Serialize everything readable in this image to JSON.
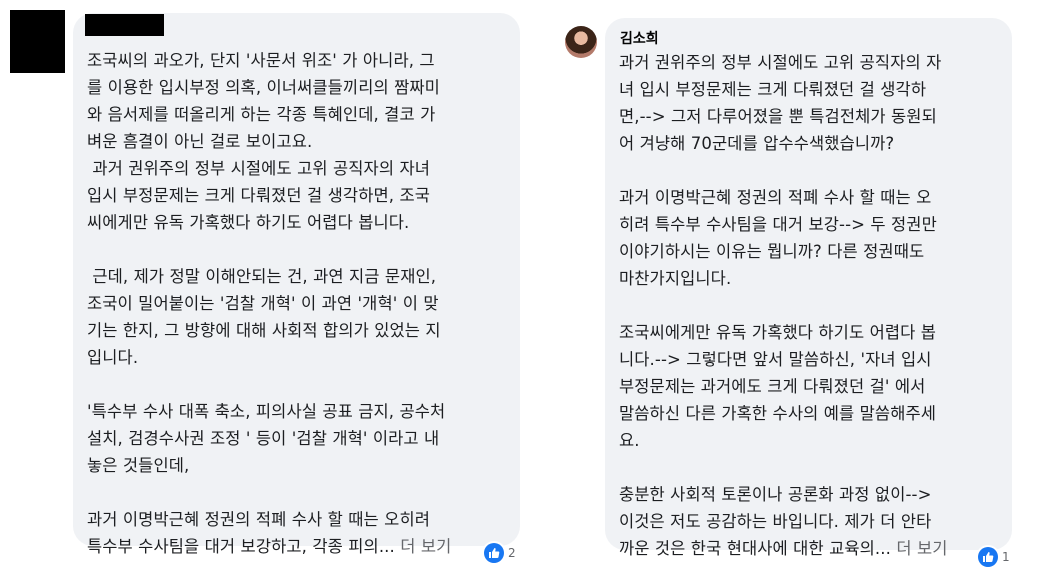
{
  "comments": [
    {
      "lines": [
        "조국씨의 과오가, 단지 '사문서 위조' 가 아니라, 그",
        "를 이용한 입시부정 의혹, 이너써클들끼리의 짬짜미",
        "와 음서제를 떠올리게 하는 각종 특혜인데, 결코 가",
        "벼운 흠결이 아닌 걸로 보이고요.",
        " 과거 권위주의 정부 시절에도 고위 공직자의 자녀",
        "입시 부정문제는 크게 다뤄졌던 걸 생각하면, 조국",
        "씨에게만 유독 가혹했다 하기도 어렵다 봅니다.",
        "",
        " 근데, 제가 정말 이해안되는 건, 과연 지금 문재인,",
        "조국이 밀어붙이는 '검찰 개혁' 이 과연 '개혁' 이 맞",
        "기는 한지, 그 방향에 대해 사회적 합의가 있었는 지",
        "입니다.",
        "",
        "'특수부 수사 대폭 축소, 피의사실 공표 금지, 공수처",
        "설치, 검경수사권 조정 ' 등이 '검찰 개혁' 이라고 내",
        "놓은 것들인데,",
        "",
        "과거 이명박근혜 정권의 적폐 수사 할 때는 오히려",
        "특수부 수사팀을 대거 보강하고, 각종 피의..."
      ],
      "see_more": "더 보기",
      "reaction_count": "2"
    },
    {
      "author": "김소희",
      "lines": [
        "과거 권위주의 정부 시절에도 고위 공직자의 자",
        "녀 입시 부정문제는 크게 다뤄졌던 걸 생각하",
        "면,--> 그저 다루어졌을 뿐 특검전체가 동원되",
        "어 겨냥해 70군데를 압수수색했습니까?",
        "",
        "과거 이명박근혜 정권의 적폐 수사 할 때는 오",
        "히려 특수부 수사팀을 대거 보강--> 두 정권만",
        "이야기하시는 이유는 뭡니까? 다른 정권때도",
        "마찬가지입니다.",
        "",
        "조국씨에게만 유독 가혹했다 하기도 어렵다 봅",
        "니다.--> 그렇다면 앞서 말씀하신, '자녀 입시",
        "부정문제는 과거에도 크게 다뤄졌던 걸' 에서",
        "말씀하신 다른 가혹한 수사의 예를 말씀해주세",
        "요.",
        "",
        "충분한 사회적 토론이나 공론화 과정 없이-->",
        "이것은 저도 공감하는 바입니다. 제가 더 안타",
        "까운 것은 한국 현대사에 대한 교육의..."
      ],
      "see_more": "더 보기",
      "reaction_count": "1"
    }
  ],
  "icons": {
    "reaction": "like-icon",
    "avatar_left": "redacted-avatar",
    "avatar_right": "profile-photo"
  },
  "colors": {
    "bubble": "#f0f2f5",
    "like": "#1877f2",
    "muted": "#65676b"
  }
}
